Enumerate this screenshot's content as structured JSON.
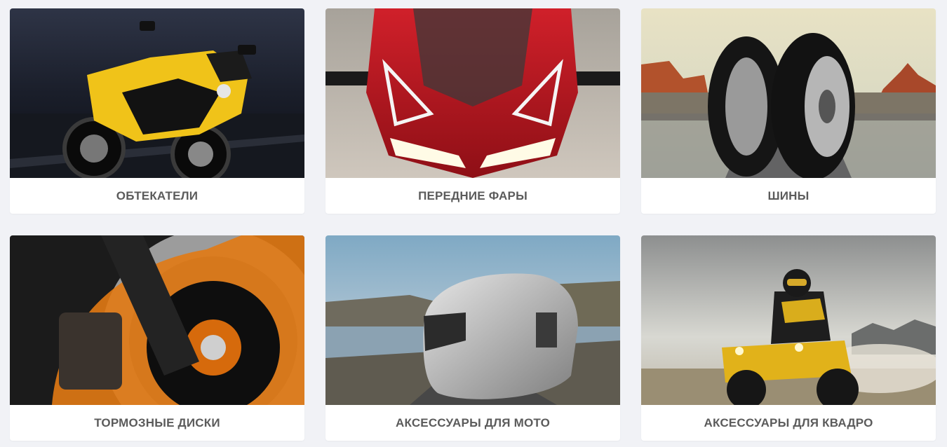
{
  "categories": [
    {
      "label": "ОБТЕКАТЕЛИ",
      "image": "yellow-sport-motorcycle-image"
    },
    {
      "label": "ПЕРЕДНИЕ ФАРЫ",
      "image": "red-motorcycle-headlight-image"
    },
    {
      "label": "ШИНЫ",
      "image": "motorcycle-tires-image"
    },
    {
      "label": "ТОРМОЗНЫЕ ДИСКИ",
      "image": "brake-disc-image"
    },
    {
      "label": "АКСЕССУАРЫ ДЛЯ МОТО",
      "image": "motorcycle-helmet-image"
    },
    {
      "label": "АКСЕССУАРЫ ДЛЯ КВАДРО",
      "image": "quad-bike-rider-image"
    }
  ]
}
